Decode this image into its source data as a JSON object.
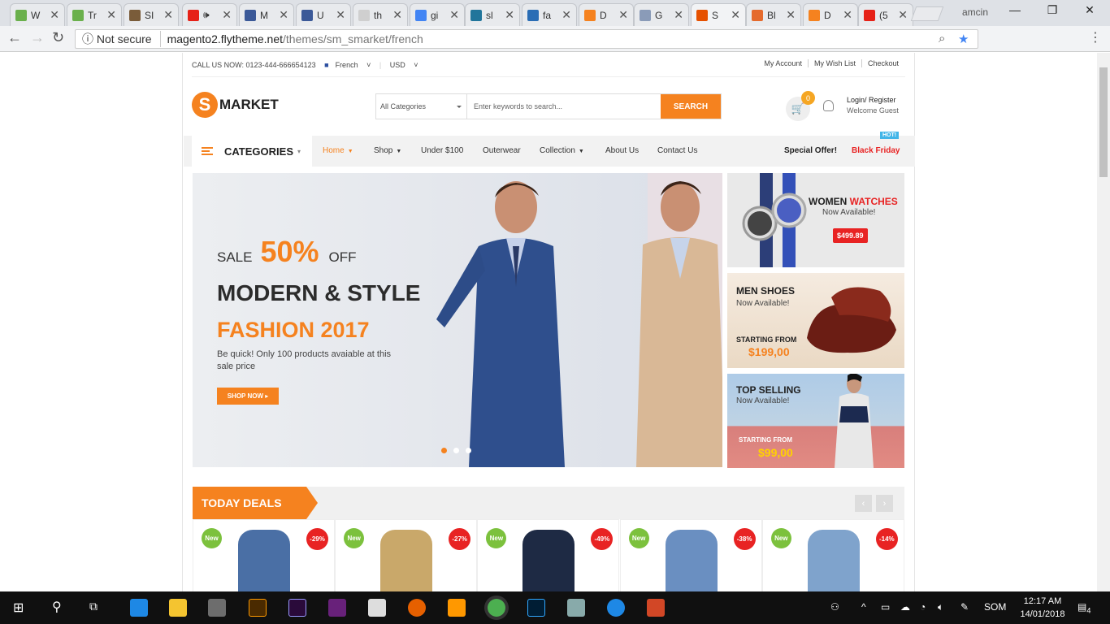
{
  "browser": {
    "tabs": [
      {
        "label": "W",
        "color": "#6ab04c"
      },
      {
        "label": "Tr",
        "color": "#6ab04c"
      },
      {
        "label": "SI",
        "color": "#7a5c3a"
      },
      {
        "label": "🕪",
        "color": "#e62117"
      },
      {
        "label": "M",
        "color": "#3b5998"
      },
      {
        "label": "U",
        "color": "#3b5998"
      },
      {
        "label": "th",
        "color": "#cfcfcf"
      },
      {
        "label": "gi",
        "color": "#4285f4"
      },
      {
        "label": "sl",
        "color": "#21759b"
      },
      {
        "label": "fa",
        "color": "#2a6db5"
      },
      {
        "label": "D",
        "color": "#f5821f"
      },
      {
        "label": "G",
        "color": "#8a9bb8"
      },
      {
        "label": "S",
        "color": "#e65100"
      },
      {
        "label": "Bl",
        "color": "#e56a2c"
      },
      {
        "label": "D",
        "color": "#f5821f"
      },
      {
        "label": "(5",
        "color": "#e62117"
      }
    ],
    "user": "amcin",
    "not_secure": "Not secure",
    "url_host": "magento2.flytheme.net",
    "url_path": "/themes/sm_smarket/french"
  },
  "header": {
    "call": "CALL US NOW: 0123-444-666654123",
    "language": "French",
    "currency": "USD",
    "links": [
      "My Account",
      "My Wish List",
      "Checkout"
    ],
    "logo": "MARKET",
    "logo_mark": "S",
    "search_category": "All Categories",
    "search_placeholder": "Enter keywords to search...",
    "search_button": "SEARCH",
    "cart_count": "0",
    "login": "Login/ Register",
    "welcome": "Welcome Guest"
  },
  "menu": {
    "categories": "CATEGORIES",
    "items": [
      "Home",
      "Shop",
      "Under $100",
      "Outerwear",
      "Collection",
      "About Us",
      "Contact Us"
    ],
    "special": "Special Offer!",
    "black_friday": "Black Friday",
    "hot": "HOT!"
  },
  "hero": {
    "sale_prefix": "SALE",
    "sale_pct": "50%",
    "sale_suffix": "OFF",
    "title": "MODERN & STYLE",
    "subtitle": "FASHION 2017",
    "desc": "Be quick! Only 100 products avaiable at this sale price",
    "cta": "SHOP NOW ▸",
    "slide_active": 1,
    "slide_count": 3
  },
  "banners": [
    {
      "title": "WOMEN",
      "title_accent": "WATCHES",
      "sub": "Now Available!",
      "price": "$499.89"
    },
    {
      "title": "MEN SHOES",
      "sub": "Now Available!",
      "starting": "STARTING FROM",
      "price": "$199,00"
    },
    {
      "title": "TOP SELLING",
      "sub": "Now Available!",
      "starting": "STARTING FROM",
      "price": "$99,00"
    }
  ],
  "deals": {
    "title": "TODAY DEALS",
    "prev": "‹",
    "next": "›",
    "products": [
      {
        "badge": "New",
        "discount": "-29%"
      },
      {
        "badge": "New",
        "discount": "-27%"
      },
      {
        "badge": "New",
        "discount": "-49%"
      },
      {
        "badge": "New",
        "discount": "-38%"
      },
      {
        "badge": "New",
        "discount": "-14%"
      }
    ]
  },
  "taskbar": {
    "lang": "SOM",
    "time": "12:17 AM",
    "date": "14/01/2018",
    "notifications": "4"
  }
}
